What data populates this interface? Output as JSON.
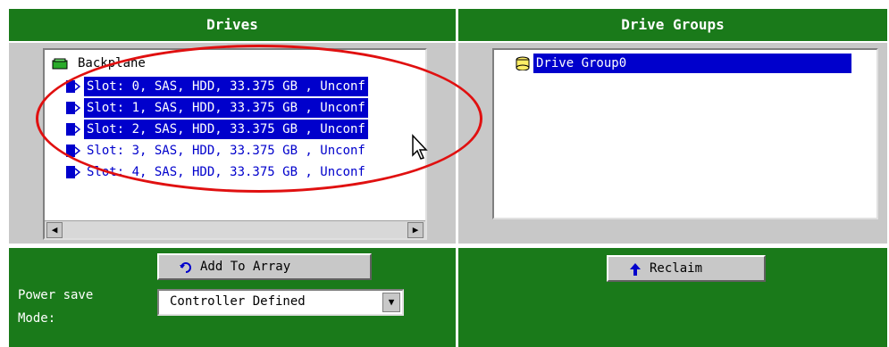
{
  "drives_panel": {
    "title": "Drives",
    "tree": {
      "root": "Backplane",
      "slots": [
        {
          "label": "Slot: 0, SAS, HDD, 33.375 GB , Unconf",
          "selected": true
        },
        {
          "label": "Slot: 1, SAS, HDD, 33.375 GB , Unconf",
          "selected": true
        },
        {
          "label": "Slot: 2, SAS, HDD, 33.375 GB , Unconf",
          "selected": true
        },
        {
          "label": "Slot: 3, SAS, HDD, 33.375 GB , Unconf",
          "selected": false
        },
        {
          "label": "Slot: 4, SAS, HDD, 33.375 GB , Unconf",
          "selected": false
        }
      ]
    },
    "add_button": "Add To Array",
    "power_save_label_1": "Power save",
    "power_save_label_2": "Mode:",
    "power_save_value": "Controller Defined"
  },
  "groups_panel": {
    "title": "Drive Groups",
    "group_label": "Drive Group0",
    "reclaim_button": "Reclaim"
  },
  "colors": {
    "panel_green": "#1a7a1a",
    "selection_blue": "#0000cc",
    "highlight_ring": "#e01010"
  }
}
